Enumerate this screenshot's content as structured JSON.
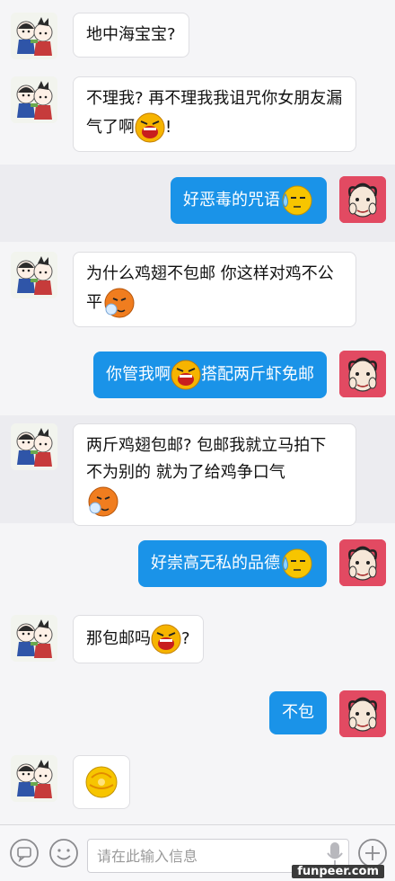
{
  "messages": [
    {
      "side": "in",
      "text": "地中海宝宝?"
    },
    {
      "side": "in",
      "text_a": "不理我? 再不理我我诅咒你女朋友漏气了啊",
      "text_b": "!",
      "emoji": "angry-shout-emoji"
    },
    {
      "side": "out",
      "text": "好恶毒的咒语",
      "emoji": "sweat-emoji"
    },
    {
      "side": "in",
      "text": "为什么鸡翅不包邮 你这样对鸡不公平",
      "emoji": "sneeze-emoji"
    },
    {
      "side": "out",
      "text_a": "你管我啊",
      "text_b": "搭配两斤虾免邮",
      "emoji": "angry-shout-emoji"
    },
    {
      "side": "in",
      "text": "两斤鸡翅包邮? 包邮我就立马拍下 不为别的 就为了给鸡争口气",
      "emoji": "sneeze-emoji"
    },
    {
      "side": "out",
      "text": "好崇高无私的品德",
      "emoji": "sweat-emoji"
    },
    {
      "side": "in",
      "text_a": "那包邮吗",
      "text_b": "?",
      "emoji": "angry-shout-emoji"
    },
    {
      "side": "out",
      "text": "不包"
    },
    {
      "side": "in",
      "emoji": "spin-emoji"
    }
  ],
  "input": {
    "placeholder": "请在此输入信息"
  },
  "watermark": "funpeer.com",
  "colors": {
    "outgoing_bubble": "#1a93e8",
    "incoming_bubble": "#ffffff",
    "self_avatar_bg": "#e24a62"
  }
}
